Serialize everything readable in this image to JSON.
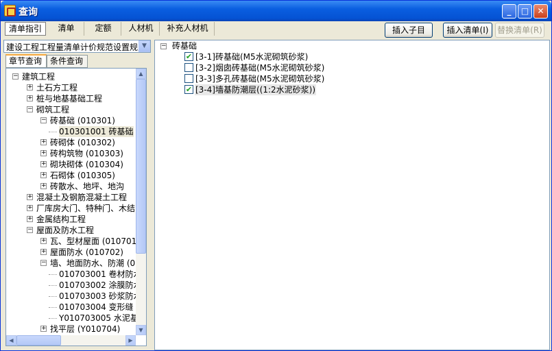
{
  "window": {
    "title": "查询",
    "buttons": {
      "minimize": "_",
      "maximize": "□",
      "close": "✕"
    }
  },
  "toolbar": {
    "tabs": [
      "清单指引",
      "清单",
      "定额",
      "人材机",
      "补充人材机"
    ],
    "active_tab": "清单指引",
    "insert_child_label": "插入子目",
    "insert_list_label": "插入清单(I)",
    "replace_list_label": "替换清单(R)"
  },
  "left": {
    "combo_value": "建设工程工程量清单计价规范设置规则",
    "tabs": [
      "章节查询",
      "条件查询"
    ],
    "active_tab": "章节查询",
    "tree": [
      {
        "level": 0,
        "exp": "-",
        "label": "建筑工程"
      },
      {
        "level": 1,
        "exp": "+",
        "label": "土石方工程"
      },
      {
        "level": 1,
        "exp": "+",
        "label": "桩与地基基础工程"
      },
      {
        "level": 1,
        "exp": "-",
        "label": "砌筑工程"
      },
      {
        "level": 2,
        "exp": "-",
        "label": "砖基础 (010301)"
      },
      {
        "level": 3,
        "exp": "",
        "label": "010301001  砖基础",
        "selected": true
      },
      {
        "level": 2,
        "exp": "+",
        "label": "砖砌体 (010302)"
      },
      {
        "level": 2,
        "exp": "+",
        "label": "砖构筑物 (010303)"
      },
      {
        "level": 2,
        "exp": "+",
        "label": "砌块砌体 (010304)"
      },
      {
        "level": 2,
        "exp": "+",
        "label": "石砌体 (010305)"
      },
      {
        "level": 2,
        "exp": "+",
        "label": "砖散水、地坪、地沟"
      },
      {
        "level": 1,
        "exp": "+",
        "label": "混凝土及钢筋混凝土工程"
      },
      {
        "level": 1,
        "exp": "+",
        "label": "厂库房大门、特种门、木结"
      },
      {
        "level": 1,
        "exp": "+",
        "label": "金属结构工程"
      },
      {
        "level": 1,
        "exp": "-",
        "label": "屋面及防水工程"
      },
      {
        "level": 2,
        "exp": "+",
        "label": "瓦、型材屋面 (010701)"
      },
      {
        "level": 2,
        "exp": "+",
        "label": "屋面防水 (010702)"
      },
      {
        "level": 2,
        "exp": "-",
        "label": "墙、地面防水、防潮 (01"
      },
      {
        "level": 3,
        "exp": "",
        "label": "010703001  卷材防水"
      },
      {
        "level": 3,
        "exp": "",
        "label": "010703002  涂膜防水"
      },
      {
        "level": 3,
        "exp": "",
        "label": "010703003  砂浆防水"
      },
      {
        "level": 3,
        "exp": "",
        "label": "010703004  变形缝"
      },
      {
        "level": 3,
        "exp": "",
        "label": "Y010703005  水泥基"
      },
      {
        "level": 2,
        "exp": "+",
        "label": "找平层 (Y010704)"
      }
    ]
  },
  "right": {
    "root_label": "砖基础",
    "items": [
      {
        "label": "[3-1]砖基础(M5水泥砌筑砂浆)",
        "checked": true
      },
      {
        "label": "[3-2]烟囱砖基础(M5水泥砌筑砂浆)",
        "checked": false
      },
      {
        "label": "[3-3]多孔砖基础(M5水泥砌筑砂浆)",
        "checked": false
      },
      {
        "label": "[3-4]墙基防潮层((1:2水泥砂浆))",
        "checked": true,
        "selected": true
      }
    ]
  },
  "colors": {
    "title_bar": "#0a5ee0",
    "window_bg": "#ece9d8",
    "check": "#21a121",
    "tab_highlight": "#f7a93e"
  }
}
